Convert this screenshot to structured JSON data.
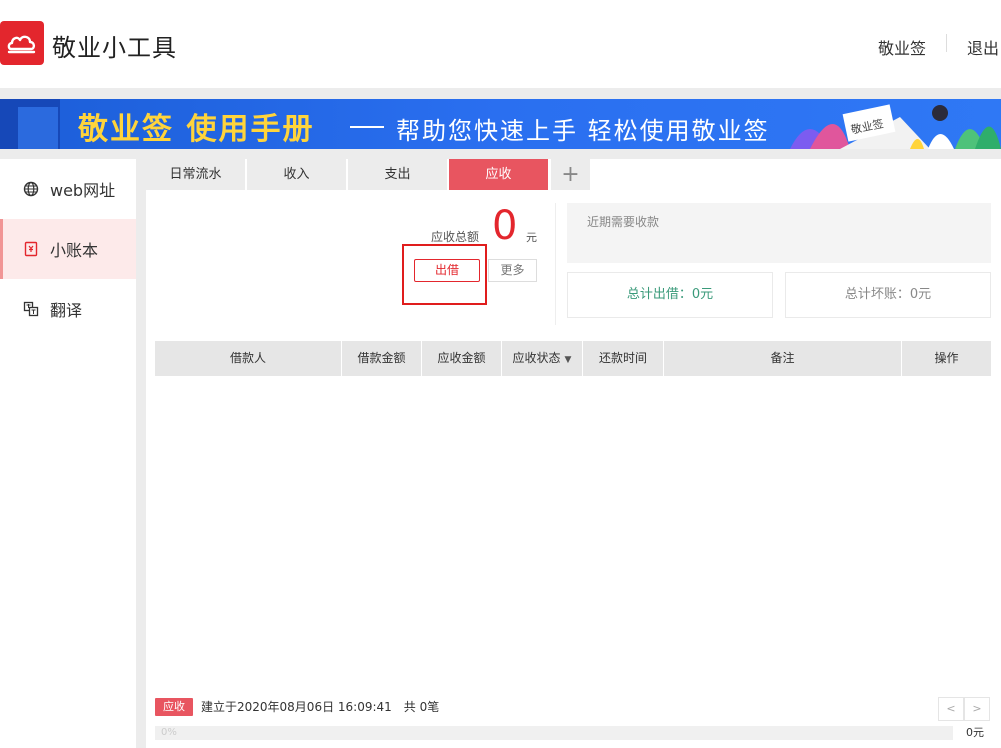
{
  "header": {
    "app_title": "敬业小工具",
    "nav": {
      "sign_label": "敬业签",
      "logout_label": "退出"
    },
    "logo_icon": "cloud-icon",
    "brand_color": "#e3262d"
  },
  "banner": {
    "title": "敬业签 使用手册",
    "subtitle": "帮助您快速上手  轻松使用敬业签",
    "book_text": "敬业签"
  },
  "sidebar": {
    "items": [
      {
        "label": "web网址",
        "icon": "globe-icon",
        "active": false
      },
      {
        "label": "小账本",
        "icon": "ledger-icon",
        "active": true
      },
      {
        "label": "翻译",
        "icon": "translate-icon",
        "active": false
      }
    ]
  },
  "tabs": [
    {
      "label": "日常流水",
      "active": false
    },
    {
      "label": "收入",
      "active": false
    },
    {
      "label": "支出",
      "active": false
    },
    {
      "label": "应收",
      "active": true
    }
  ],
  "summary": {
    "label": "应收总额",
    "value": "0",
    "unit": "元",
    "lend_button": "出借",
    "more_button": "更多"
  },
  "upcoming": {
    "label": "近期需要收款"
  },
  "stats": {
    "total_lent": "总计出借：0元",
    "total_bad_debt": "总计坏账：0元"
  },
  "table": {
    "columns": [
      "借款人",
      "借款金额",
      "应收金额",
      "应收状态",
      "还款时间",
      "备注",
      "操作"
    ],
    "rows": []
  },
  "footer": {
    "badge": "应收",
    "created_text": "建立于2020年08月06日 16:09:41",
    "count_text": "共 0笔",
    "prev": "<",
    "next": ">",
    "progress_percent": 0,
    "progress_label": "0%",
    "amount": "0元"
  },
  "colors": {
    "accent": "#e85560",
    "banner_blue": "#2a6ff0",
    "banner_yellow": "#ffd43b",
    "stat_green": "#3a9a7a"
  }
}
